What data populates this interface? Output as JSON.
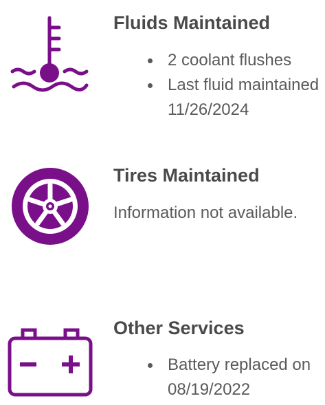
{
  "colors": {
    "accent": "#7a0f8a",
    "text": "#5a5a5a",
    "heading": "#4a4a4a"
  },
  "fluids": {
    "icon": "thermometer-coolant-icon",
    "title": "Fluids Maintained",
    "bullets": [
      {
        "count": "2",
        "text": " coolant flushes"
      },
      {
        "line1": "Last fluid maintained",
        "line2": "11/26/2024"
      }
    ]
  },
  "tires": {
    "icon": "tire-icon",
    "title": "Tires Maintained",
    "info": "Information not available."
  },
  "other": {
    "icon": "battery-icon",
    "title": "Other Services",
    "bullets": [
      {
        "line1": "Battery replaced on",
        "line2": "08/19/2022"
      }
    ]
  }
}
